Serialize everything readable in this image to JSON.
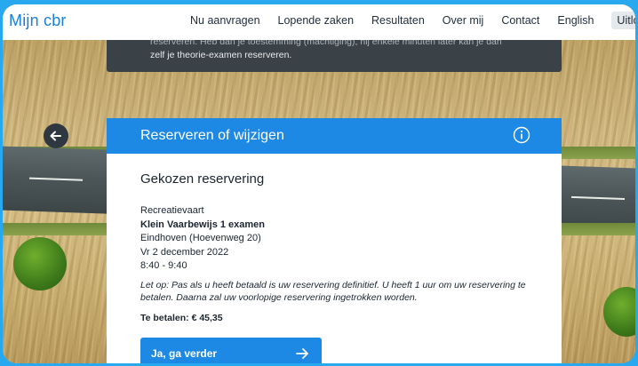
{
  "header": {
    "logo": "Mijn cbr",
    "nav": [
      "Nu aanvragen",
      "Lopende zaken",
      "Resultaten",
      "Over mij",
      "Contact",
      "English"
    ],
    "logout": "Uitlogg"
  },
  "banner": {
    "line1_partial": "reserveren. Heb dan je toestemming (machtiging), hij enkele minuten later kan je dan",
    "line2": "zelf je theorie-examen reserveren."
  },
  "card": {
    "title": "Reserveren of wijzigen",
    "heading": "Gekozen reservering",
    "category": "Recreatievaart",
    "exam": "Klein Vaarbewijs 1 examen",
    "location": "Eindhoven (Hoevenweg 20)",
    "date": "Vr 2 december 2022",
    "time": "8:40 - 9:40",
    "note": "Let op: Pas als u heeft betaald is uw reservering definitief. U heeft 1 uur om uw reservering te betalen. Daarna zal uw voorlopige reservering ingetrokken worden.",
    "pay": "Te betalen: € 45,35",
    "button": "Ja, ga verder"
  },
  "icons": {
    "back": "arrow-left-icon",
    "info": "info-icon",
    "continue": "arrow-right-icon"
  },
  "colors": {
    "brand_blue": "#1e88e5",
    "banner_dark": "#3a4248",
    "frame_blue": "#28a8ee"
  }
}
